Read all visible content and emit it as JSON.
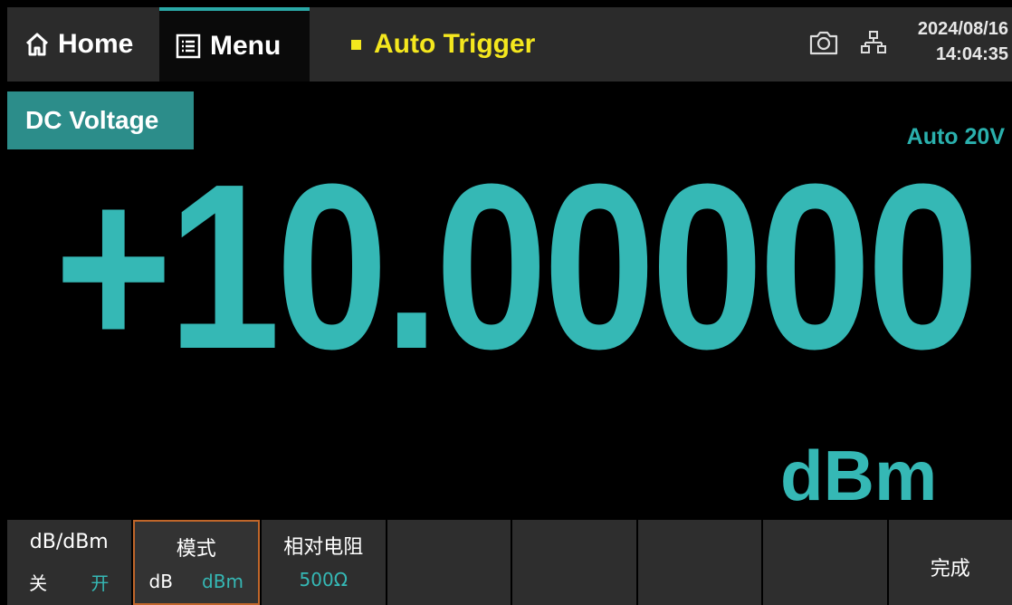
{
  "topbar": {
    "home_label": "Home",
    "menu_label": "Menu",
    "trigger_label": "Auto Trigger",
    "date": "2024/08/16",
    "time": "14:04:35"
  },
  "main": {
    "function_label": "DC Voltage",
    "range_label": "Auto 20V",
    "reading": "+10.00000",
    "unit": "dBm"
  },
  "softkeys": [
    {
      "title": "dB/dBm",
      "opt_a": "关",
      "opt_b": "开"
    },
    {
      "title": "模式",
      "opt_a": "dB",
      "opt_b": "dBm"
    },
    {
      "title": "相对电阻",
      "value": "500Ω"
    },
    {
      "title": ""
    },
    {
      "title": ""
    },
    {
      "title": ""
    },
    {
      "title": ""
    },
    {
      "title": "完成"
    }
  ],
  "colors": {
    "accent": "#35b8b5",
    "trigger": "#f4e71e",
    "active_border": "#c0662a"
  },
  "icons": [
    "home-icon",
    "menu-icon",
    "camera-icon",
    "network-icon"
  ]
}
